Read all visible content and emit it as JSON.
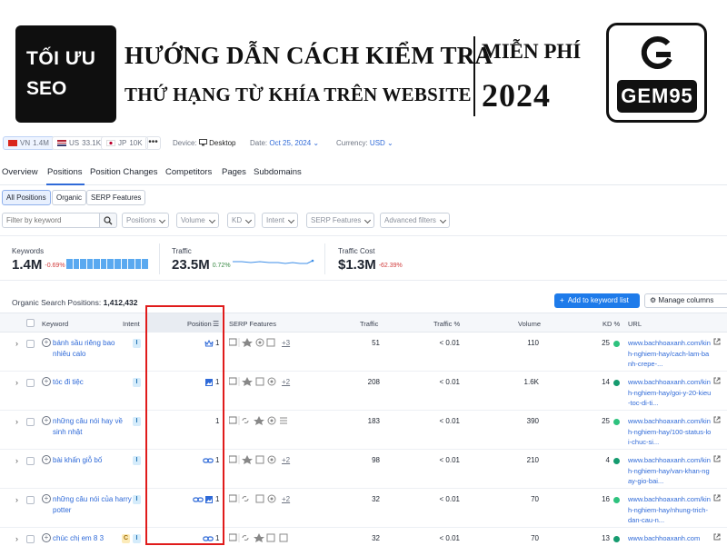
{
  "banner": {
    "badge_line1": "TỐI ƯU",
    "badge_line2": "SEO",
    "headline_line1": "HƯỚNG DẪN CÁCH  KIỂM TRA",
    "headline_line2": "THỨ HẠNG TỪ KHÍA TRÊN WEBSITE",
    "free": "MIỄN PHÍ",
    "year": "2024",
    "logo_text": "GEM95"
  },
  "topbar": {
    "databases": [
      {
        "code": "VN",
        "count": "1.4M"
      },
      {
        "code": "US",
        "count": "33.1K"
      },
      {
        "code": "JP",
        "count": "10K"
      }
    ],
    "more": "•••",
    "device_label": "Device:",
    "device_value": "Desktop",
    "date_label": "Date:",
    "date_value": "Oct 25, 2024",
    "currency_label": "Currency:",
    "currency_value": "USD"
  },
  "tabs": [
    "Overview",
    "Positions",
    "Position Changes",
    "Competitors",
    "Pages",
    "Subdomains"
  ],
  "subtabs": [
    "All Positions",
    "Organic",
    "SERP Features"
  ],
  "filters": {
    "search_placeholder": "Filter by keyword",
    "dropdowns": [
      "Positions",
      "Volume",
      "KD",
      "Intent",
      "SERP Features",
      "Advanced filters"
    ]
  },
  "summary": {
    "keywords": {
      "label": "Keywords",
      "value": "1.4M",
      "change": "-0.69%"
    },
    "traffic": {
      "label": "Traffic",
      "value": "23.5M",
      "change": "0.72%"
    },
    "traffic_cost": {
      "label": "Traffic Cost",
      "value": "$1.3M",
      "change": "-62.39%"
    }
  },
  "table": {
    "title": "Organic Search Positions:",
    "count": "1,412,432",
    "add_button": "Add to keyword list",
    "manage_button": "Manage columns",
    "headers": {
      "keyword": "Keyword",
      "intent": "Intent",
      "position": "Position",
      "serp": "SERP Features",
      "traffic": "Traffic",
      "traffic_pct": "Traffic %",
      "volume": "Volume",
      "kd": "KD %",
      "url": "URL"
    },
    "rows": [
      {
        "keyword": "bánh sầu riêng bao nhiêu calo",
        "intent": [
          "I"
        ],
        "position": "1",
        "serp_more": "+3",
        "traffic": "51",
        "traffic_pct": "< 0.01",
        "volume": "110",
        "kd": "25",
        "url": "www.bachhoaxanh.com/kinh-nghiem-hay/cach-lam-banh-crepe-..."
      },
      {
        "keyword": "tóc đi tiệc",
        "intent": [
          "I"
        ],
        "position": "1",
        "serp_more": "+2",
        "traffic": "208",
        "traffic_pct": "< 0.01",
        "volume": "1.6K",
        "kd": "14",
        "url": "www.bachhoaxanh.com/kinh-nghiem-hay/goi-y-20-kieu-toc-di-ti..."
      },
      {
        "keyword": "những câu nói hay về sinh nhật",
        "intent": [
          "I"
        ],
        "position": "1",
        "serp_more": "",
        "traffic": "183",
        "traffic_pct": "< 0.01",
        "volume": "390",
        "kd": "25",
        "url": "www.bachhoaxanh.com/kinh-nghiem-hay/100-status-loi-chuc-si..."
      },
      {
        "keyword": "bài khấn giỗ bố",
        "intent": [
          "I"
        ],
        "position": "1",
        "serp_more": "+2",
        "traffic": "98",
        "traffic_pct": "< 0.01",
        "volume": "210",
        "kd": "4",
        "url": "www.bachhoaxanh.com/kinh-nghiem-hay/van-khan-ngay-gio-bai..."
      },
      {
        "keyword": "những câu nói của harry potter",
        "intent": [
          "I"
        ],
        "position": "1",
        "serp_more": "+2",
        "traffic": "32",
        "traffic_pct": "< 0.01",
        "volume": "70",
        "kd": "16",
        "url": "www.bachhoaxanh.com/kinh-nghiem-hay/nhung-trich-dan-cau-n..."
      },
      {
        "keyword": "chúc chị em 8 3",
        "intent": [
          "C",
          "I"
        ],
        "position": "1",
        "serp_more": "",
        "traffic": "32",
        "traffic_pct": "< 0.01",
        "volume": "70",
        "kd": "13",
        "url": "www.bachhoaxanh.com"
      }
    ]
  },
  "colors": {
    "accent": "#2f6ad8",
    "button": "#1e7bea",
    "highlight_box": "#e01b1b",
    "kd_green": "#2ec27e",
    "kd_teal": "#159b6f"
  }
}
